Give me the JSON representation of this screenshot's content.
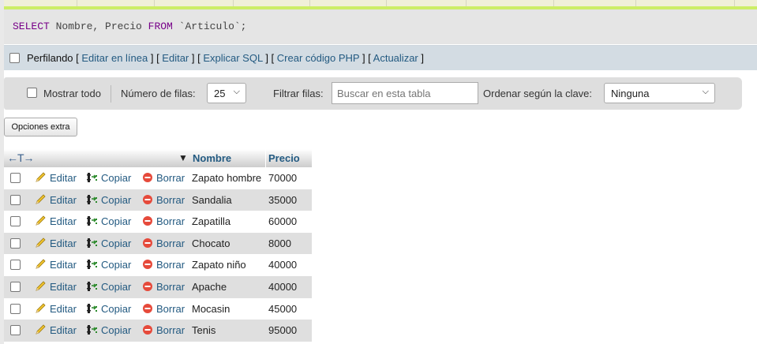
{
  "sql_query": {
    "kw_select": "SELECT",
    "columns": " Nombre, Precio ",
    "kw_from": "FROM",
    "table": " `Articulo`;"
  },
  "profiling": {
    "label": "Perfilando",
    "sep_open": " [ ",
    "sep_mid": " ] [ ",
    "sep_close": " ]",
    "links": [
      "Editar en línea",
      "Editar",
      "Explicar SQL",
      "Crear código PHP",
      "Actualizar"
    ]
  },
  "controls": {
    "show_all_label": "Mostrar todo",
    "rows_label": "Número de filas:",
    "rows_value": "25",
    "filter_label": "Filtrar filas:",
    "filter_placeholder": "Buscar en esta tabla",
    "sort_label": "Ordenar según la clave:",
    "sort_value": "Ninguna"
  },
  "extra_button": "Opciones extra",
  "table": {
    "columns": [
      "Nombre",
      "Precio"
    ],
    "actions": {
      "edit": "Editar",
      "copy": "Copiar",
      "delete": "Borrar"
    },
    "rows": [
      {
        "nombre": "Zapato hombre",
        "precio": "70000"
      },
      {
        "nombre": "Sandalia",
        "precio": "35000"
      },
      {
        "nombre": "Zapatilla",
        "precio": "60000"
      },
      {
        "nombre": "Chocato",
        "precio": "8000"
      },
      {
        "nombre": "Zapato niño",
        "precio": "40000"
      },
      {
        "nombre": "Apache",
        "precio": "40000"
      },
      {
        "nombre": "Mocasin",
        "precio": "45000"
      },
      {
        "nombre": "Tenis",
        "precio": "95000"
      }
    ]
  },
  "colors": {
    "link": "#235a81",
    "keyword": "#770088",
    "delete_icon": "#e64a3b"
  }
}
